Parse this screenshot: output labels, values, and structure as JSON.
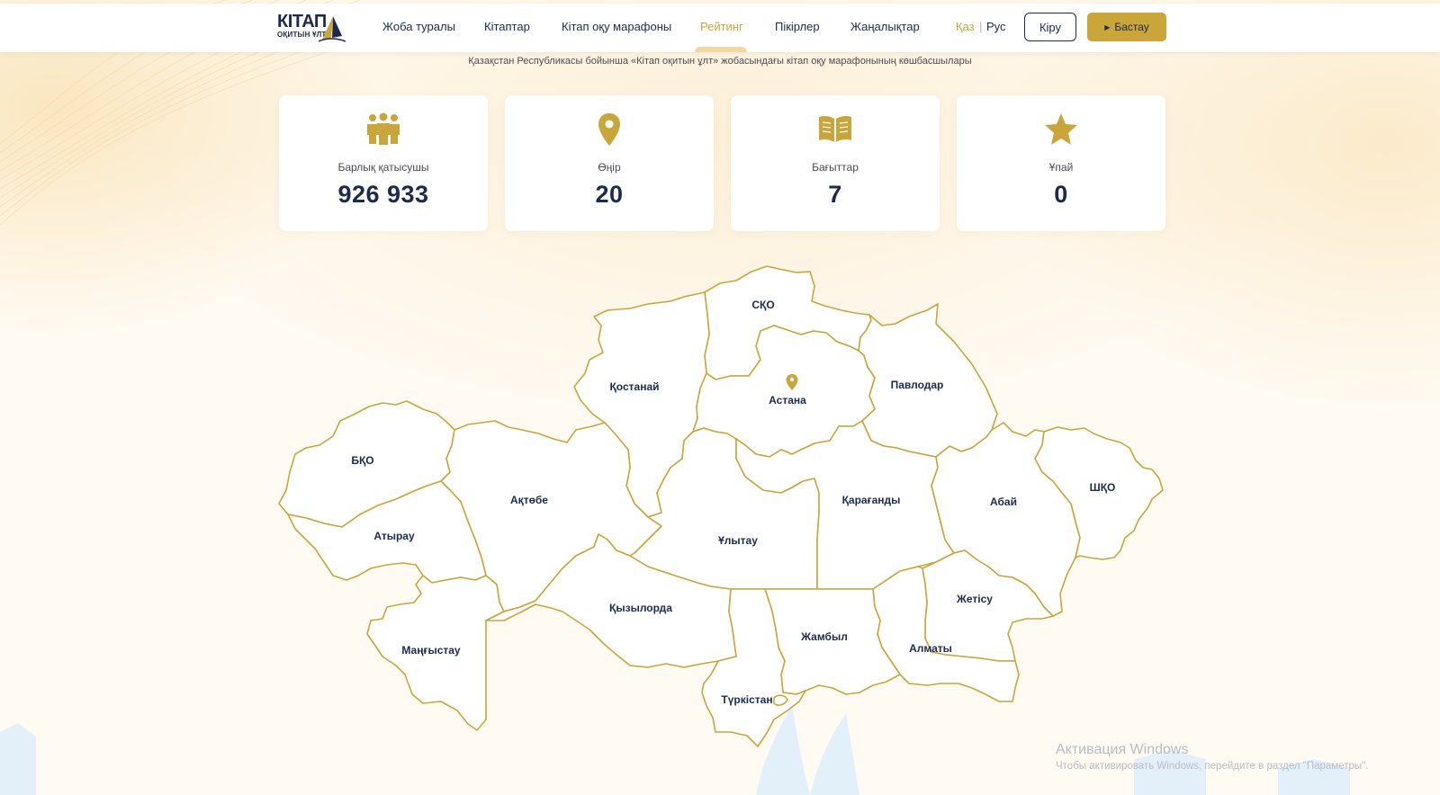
{
  "brand": {
    "logo_main": "КІТАП",
    "logo_sub": "ОҚИТЫН ҰЛТ"
  },
  "nav": {
    "items": [
      {
        "label": "Жоба туралы",
        "active": false
      },
      {
        "label": "Кітаптар",
        "active": false
      },
      {
        "label": "Кітап оқу марафоны",
        "active": false
      },
      {
        "label": "Рейтинг",
        "active": true
      },
      {
        "label": "Пікірлер",
        "active": false
      },
      {
        "label": "Жаңалықтар",
        "active": false
      }
    ],
    "lang_kz": "Қаз",
    "lang_sep": "|",
    "lang_ru": "Рус",
    "login": "Кіру",
    "start": "Бастау",
    "start_icon": "play-icon"
  },
  "subtitle": "Қазақстан Республикасы бойынша «Кітап оқитын ұлт» жобасындағы кітап оқу марафонының көшбасшылары",
  "stats": [
    {
      "icon": "people-icon",
      "label": "Барлық қатысушы",
      "value": "926 933"
    },
    {
      "icon": "location-pin-icon",
      "label": "Өңір",
      "value": "20"
    },
    {
      "icon": "open-book-icon",
      "label": "Бағыттар",
      "value": "7"
    },
    {
      "icon": "star-icon",
      "label": "Ұпай",
      "value": "0"
    }
  ],
  "map": {
    "regions": [
      "СҚО",
      "Қостанай",
      "Астана",
      "Павлодар",
      "БҚО",
      "Ақтөбе",
      "Қарағанды",
      "Абай",
      "ШҚО",
      "Атырау",
      "Ұлытау",
      "Қызылорда",
      "Жетісу",
      "Жамбыл",
      "Алматы",
      "Маңғыстау",
      "Түркістан"
    ]
  },
  "watermark": {
    "title": "Активация Windows",
    "subtitle": "Чтобы активировать Windows, перейдите в раздел \"Параметры\"."
  },
  "colors": {
    "accent": "#c9a53a",
    "navy": "#1d2a4d",
    "background": "#fffaf2"
  }
}
